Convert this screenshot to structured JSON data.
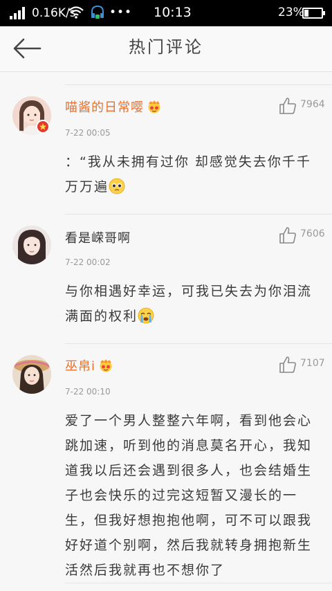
{
  "status_bar": {
    "speed": "0.16K/s",
    "time": "10:13",
    "battery": "23%",
    "dots": "•••",
    "battery_level": 0.23
  },
  "header": {
    "title": "热门评论",
    "back_icon": "back-arrow-icon"
  },
  "comments": [
    {
      "username": "喵酱的日常嘤",
      "time": "7-22 00:05",
      "likes": "7964",
      "text": "：“我从未拥有过你 却感觉失去你千千万万遍",
      "emoji": "pleading-face",
      "name_color": "#e8702a"
    },
    {
      "username": "看是嵘哥啊",
      "time": "7-22 00:02",
      "likes": "7606",
      "text": "与你相遇好幸运，可我已失去为你泪流满面的权利",
      "emoji": "crying-face",
      "name_color": "#333333"
    },
    {
      "username": "巫帛i",
      "time": "7-22 00:10",
      "likes": "7107",
      "text": "爱了一个男人整整六年啊，看到他会心跳加速，听到他的消息莫名开心，我知道我以后还会遇到很多人，也会结婚生子也会快乐的过完这短暂又漫长的一生，但我好想抱抱他啊，可不可以跟我好好道个别啊，然后我就转身拥抱新生活然后我就再也不想你了",
      "emoji": "",
      "name_color": "#e8702a"
    }
  ]
}
